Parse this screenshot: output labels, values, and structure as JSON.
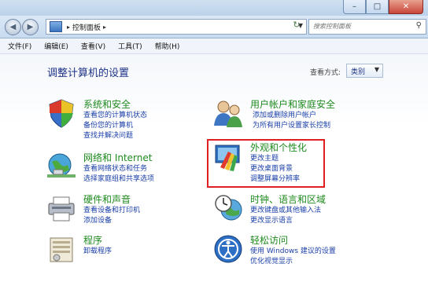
{
  "window": {
    "minimize_glyph": "–",
    "maximize_glyph": "□",
    "close_glyph": "✕"
  },
  "nav": {
    "back_glyph": "◀",
    "forward_glyph": "▶",
    "breadcrumb": "控制面板",
    "breadcrumb_arrow": "▸",
    "search_placeholder": "搜索控制面板"
  },
  "menu": [
    "文件(F)",
    "编辑(E)",
    "查看(V)",
    "工具(T)",
    "帮助(H)"
  ],
  "main": {
    "heading": "调整计算机的设置",
    "view_by_label": "查看方式:",
    "view_by_value": "类别"
  },
  "categories": {
    "system": {
      "title": "系统和安全",
      "links": [
        "查看您的计算机状态",
        "备份您的计算机",
        "查找并解决问题"
      ]
    },
    "network": {
      "title": "网络和 Internet",
      "links": [
        "查看网络状态和任务",
        "选择家庭组和共享选项"
      ]
    },
    "hardware": {
      "title": "硬件和声音",
      "links": [
        "查看设备和打印机",
        "添加设备"
      ]
    },
    "programs": {
      "title": "程序",
      "links": [
        "卸载程序"
      ]
    },
    "users": {
      "title": "用户帐户和家庭安全",
      "links": [
        "添加或删除用户帐户",
        "为所有用户设置家长控制"
      ]
    },
    "appearance": {
      "title": "外观和个性化",
      "links": [
        "更改主题",
        "更改桌面背景",
        "调整屏幕分辨率"
      ]
    },
    "clock": {
      "title": "时钟、语言和区域",
      "links": [
        "更改键盘或其他输入法",
        "更改显示语言"
      ]
    },
    "ease": {
      "title": "轻松访问",
      "links": [
        "使用 Windows 建议的设置",
        "优化视觉显示"
      ]
    }
  },
  "icons": {
    "system": "shield-icon",
    "network": "globe-network-icon",
    "hardware": "printer-icon",
    "programs": "programs-icon",
    "users": "users-icon",
    "appearance": "monitor-palette-icon",
    "clock": "clock-globe-icon",
    "ease": "accessibility-icon"
  },
  "colors": {
    "category_title": "#1e8a1e",
    "link": "#1a3fa8",
    "heading": "#1e3287",
    "highlight_border": "#e02020"
  }
}
